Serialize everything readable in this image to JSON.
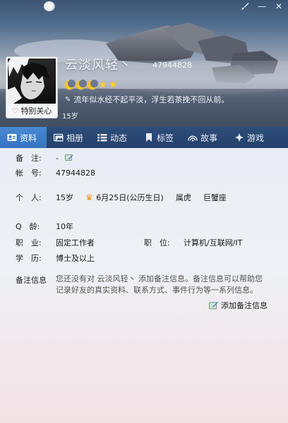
{
  "window": {
    "controls": {
      "skin_icon": "brush-icon",
      "minimize_glyph": "—",
      "close_glyph": "✕"
    }
  },
  "profile": {
    "nickname": "云淡风轻丶",
    "qq_number": "47944828",
    "special_care_label": "特别关心",
    "signature": "流年似水经不起平淡，浮生若茶挽不回从前。",
    "age": "15岁",
    "level_icons": [
      "moon",
      "moon",
      "moon",
      "star",
      "star"
    ]
  },
  "tabs": [
    {
      "label": "资料",
      "icon": "id-card-icon",
      "active": true
    },
    {
      "label": "相册",
      "icon": "photo-icon",
      "active": false
    },
    {
      "label": "动态",
      "icon": "feed-icon",
      "active": false
    },
    {
      "label": "标签",
      "icon": "tag-icon",
      "active": false
    },
    {
      "label": "故事",
      "icon": "story-icon",
      "active": false
    },
    {
      "label": "游戏",
      "icon": "game-icon",
      "active": false
    }
  ],
  "info": {
    "remark": {
      "label": "备　注:",
      "value": "-"
    },
    "account": {
      "label": "帐　号:",
      "value": "47944828"
    },
    "personal": {
      "label": "个　人:",
      "age": "15岁",
      "birthday": "6月25日(公历生日)",
      "zodiac": "属虎",
      "constellation": "巨蟹座"
    },
    "q_age": {
      "label": "Q　龄:",
      "value": "10年"
    },
    "career": {
      "label": "职　业:",
      "value": "固定工作者"
    },
    "position": {
      "label": "职　位:",
      "value": "计算机/互联网/IT"
    },
    "education": {
      "label": "学　历:",
      "value": "博士及以上"
    },
    "memo": {
      "label": "备注信息",
      "text": "您还没有对 云淡风轻丶 添加备注信息。备注信息可以帮助您记录好友的真实资料、联系方式、事件行为等一系列信息。",
      "add_label": "添加备注信息"
    }
  },
  "colors": {
    "tab_bar": "#24406b",
    "tab_active": "#3d7cc8",
    "accent_star": "#ffcf2c",
    "crown": "#e79c1a"
  }
}
